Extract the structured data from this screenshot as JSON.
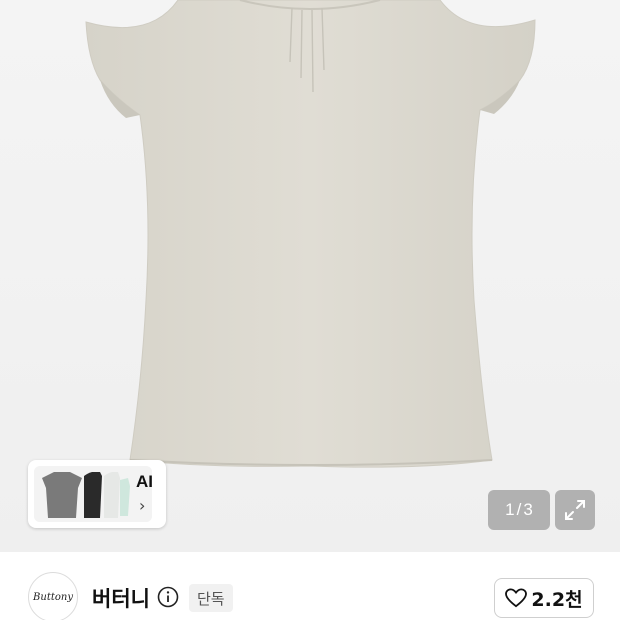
{
  "product_gallery": {
    "current_page": "1",
    "separator": "/",
    "total_pages": "3"
  },
  "ai_recommend": {
    "label": "AI",
    "chevron": "›",
    "thumbnail_colors": [
      "#7a7a7a",
      "#2a2a2a",
      "#e6e8e6",
      "#cfe7dd"
    ]
  },
  "shop": {
    "logo_text": "Buttony",
    "name": "버터니",
    "badge": "단독",
    "like_count": "2.2천"
  },
  "colors": {
    "shirt": "#dedbd1",
    "pager_bg": "#7d7d7d"
  }
}
